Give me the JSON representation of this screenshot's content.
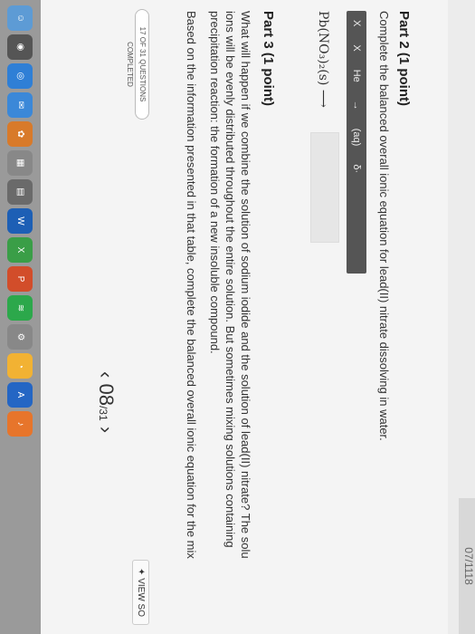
{
  "window": {
    "title": "07/1118"
  },
  "part2": {
    "heading": "Part 2   (1 point)",
    "instruction": "Complete the balanced overall ionic equation for lead(II) nitrate dissolving in water.",
    "toolbar": [
      "X",
      "X",
      "He",
      "→",
      "(aq)",
      "δ·"
    ],
    "formula": "Pb(NO₃)₂(s) ⟶"
  },
  "part3": {
    "heading": "Part 3   (1 point)",
    "p1": "What will happen if we combine the solution of sodium iodide and the solution of lead(II) nitrate? The solu",
    "p2": "ions will be evenly distributed throughout the entire solution. But sometimes mixing solutions containing",
    "p3": "precipitation reaction: the formation of a new insoluble compound.",
    "p4": "Based on the information presented in that table, complete the balanced overall ionic equation for the mix"
  },
  "footer": {
    "completion": "17 OF 31 QUESTIONS COMPLETED",
    "prev": "‹",
    "page": "08",
    "total": "/31",
    "next": "›",
    "view": "✦ VIEW SO"
  }
}
